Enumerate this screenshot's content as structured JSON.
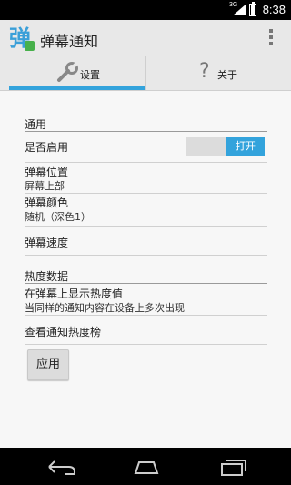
{
  "status_bar": {
    "network": "3G",
    "time": "8:38"
  },
  "app": {
    "title": "弹幕通知",
    "icon": "danmaku-app-icon",
    "icon_glyph": "弹"
  },
  "tabs": [
    {
      "label": "设置",
      "icon": "wrench-icon",
      "selected": true
    },
    {
      "label": "关于",
      "icon": "question-icon",
      "icon_glyph": "?",
      "selected": false
    }
  ],
  "settings": {
    "general": {
      "header": "通用",
      "enable_title": "是否启用",
      "enable_toggle": "打开",
      "position_title": "弹幕位置",
      "position_value": "屏幕上部",
      "color_title": "弹幕颜色",
      "color_value": "随机（深色1）",
      "speed_title": "弹幕速度"
    },
    "heat": {
      "header": "热度数据",
      "show_title": "在弹幕上显示热度值",
      "show_summary": "当同样的通知内容在设备上多次出现",
      "ranking_title": "查看通知热度榜"
    },
    "apply_label": "应用"
  },
  "nav": {
    "back": "back-icon",
    "home": "home-icon",
    "recents": "recents-icon"
  },
  "colors": {
    "accent": "#33a3dc",
    "status_bar": "#000000",
    "action_bar": "#e8e8e8"
  }
}
